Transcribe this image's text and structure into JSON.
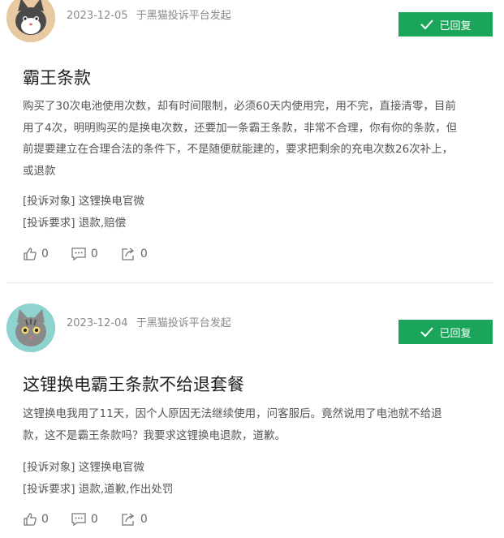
{
  "complaints": [
    {
      "date": "2023-12-05",
      "source": "于黑猫投诉平台发起",
      "status": "已回复",
      "title": "霸王条款",
      "lines": [
        "购买了30次电池使用次数，却有时间限制，必须60天内使用完，用不完，直接清零，目前",
        "用了4次，明明购买的是换电次数，还要加一条霸王条款，非常不合理，你有你的条款，但",
        "前提要建立在合理合法的条件下，不是随便就能建的，要求把剩余的充电次数26次补上，",
        "或退款"
      ],
      "target_key": "[投诉对象]",
      "target_value": "这锂换电官微",
      "demand_key": "[投诉要求]",
      "demand_value": "退款,赔偿",
      "likes": "0",
      "comments": "0",
      "shares": "0",
      "avatar_color": "#e8c9a2"
    },
    {
      "date": "2023-12-04",
      "source": "于黑猫投诉平台发起",
      "status": "已回复",
      "title": "这锂换电霸王条款不给退套餐",
      "lines": [
        "这锂换电我用了11天，因个人原因无法继续使用，问客服后。竟然说用了电池就不给退",
        "款，这不是霸王条款吗？我要求这锂换电退款，道歉。"
      ],
      "target_key": "[投诉对象]",
      "target_value": "这锂换电官微",
      "demand_key": "[投诉要求]",
      "demand_value": "退款,道歉,作出处罚",
      "likes": "0",
      "comments": "0",
      "shares": "0",
      "avatar_color": "#8fd3cf"
    }
  ],
  "colors": {
    "badge": "#1aa55a",
    "meta": "#8a8a8a"
  },
  "icons": [
    "check-icon",
    "thumbs-up-icon",
    "comment-icon",
    "share-icon",
    "cat-avatar-icon"
  ]
}
